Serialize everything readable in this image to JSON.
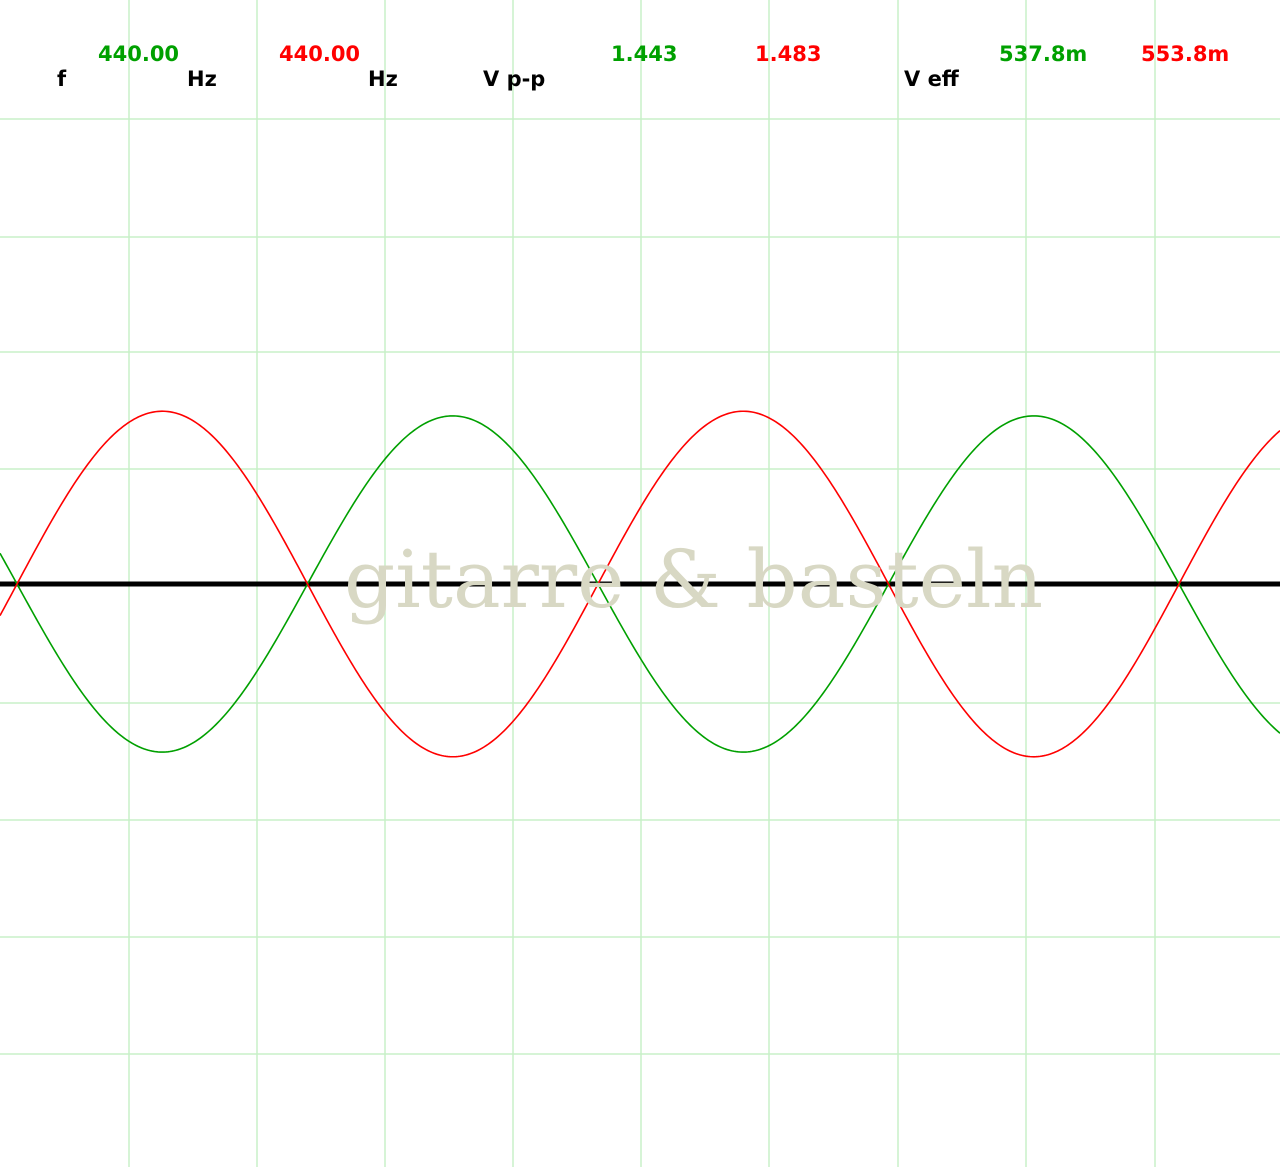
{
  "colors": {
    "background": "#ffffff",
    "grid": "#c8f0c8",
    "channel_a": "#00a000",
    "channel_b": "#ff0000",
    "zero_line": "#000000",
    "label": "#000000",
    "watermark": "#d8d8c4"
  },
  "readouts": {
    "f_label": "f",
    "freq_a": "440.00",
    "hz_unit_a": "Hz",
    "freq_b": "440.00",
    "hz_unit_b": "Hz",
    "vpp_label": "V p-p",
    "vpp_a": "1.443",
    "vpp_b": "1.483",
    "veff_label": "V eff",
    "veff_a": "537.8m",
    "veff_b": "553.8m"
  },
  "watermark": "gitarre & basteln",
  "chart_data": {
    "type": "line",
    "grid": true,
    "series": [
      {
        "channel": "A",
        "color": "#00a000",
        "frequency_hz": 440.0,
        "vpp": 1.443,
        "veff": 0.5378,
        "phase_deg": 180
      },
      {
        "channel": "B",
        "color": "#ff0000",
        "frequency_hz": 440.0,
        "vpp": 1.483,
        "veff": 0.5538,
        "phase_deg": 0
      }
    ]
  }
}
